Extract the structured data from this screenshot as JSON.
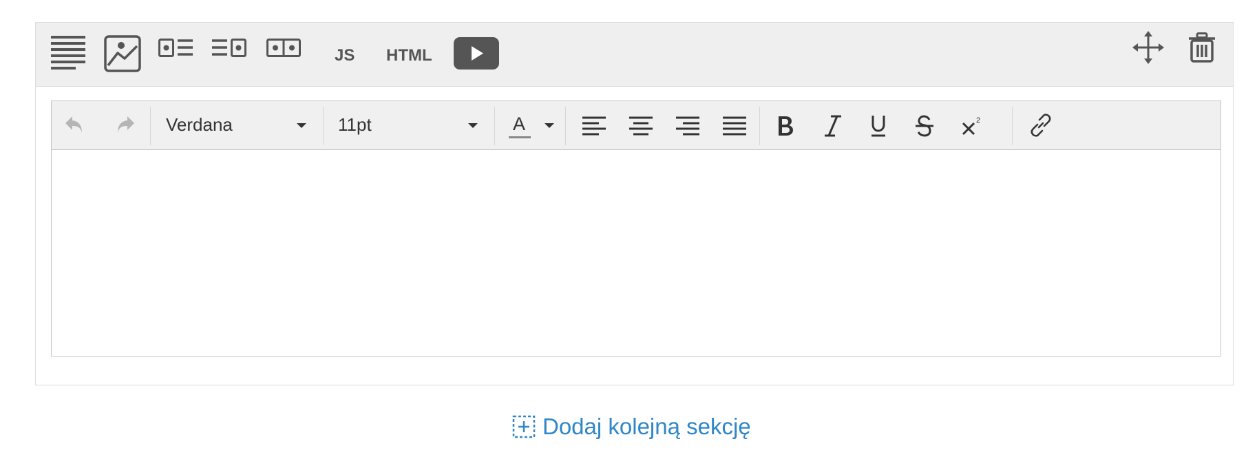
{
  "section_toolbar": {
    "tools": [
      {
        "id": "text",
        "icon": "text-block-icon"
      },
      {
        "id": "image",
        "icon": "image-icon"
      },
      {
        "id": "image-left-text",
        "icon": "image-left-text-icon"
      },
      {
        "id": "text-right-image",
        "icon": "text-image-right-icon"
      },
      {
        "id": "two-images",
        "icon": "two-images-icon"
      }
    ],
    "js_label": "JS",
    "html_label": "HTML",
    "video_icon": "play-video-icon",
    "move_icon": "move-arrows-icon",
    "delete_icon": "trash-icon"
  },
  "editor": {
    "font_family": "Verdana",
    "font_size": "11pt",
    "text_color_letter": "A",
    "text_color_underline": "#888888",
    "content": ""
  },
  "add_section": {
    "label": "Dodaj kolejną sekcję",
    "icon": "dashed-plus-icon",
    "color": "#2f86c8"
  }
}
